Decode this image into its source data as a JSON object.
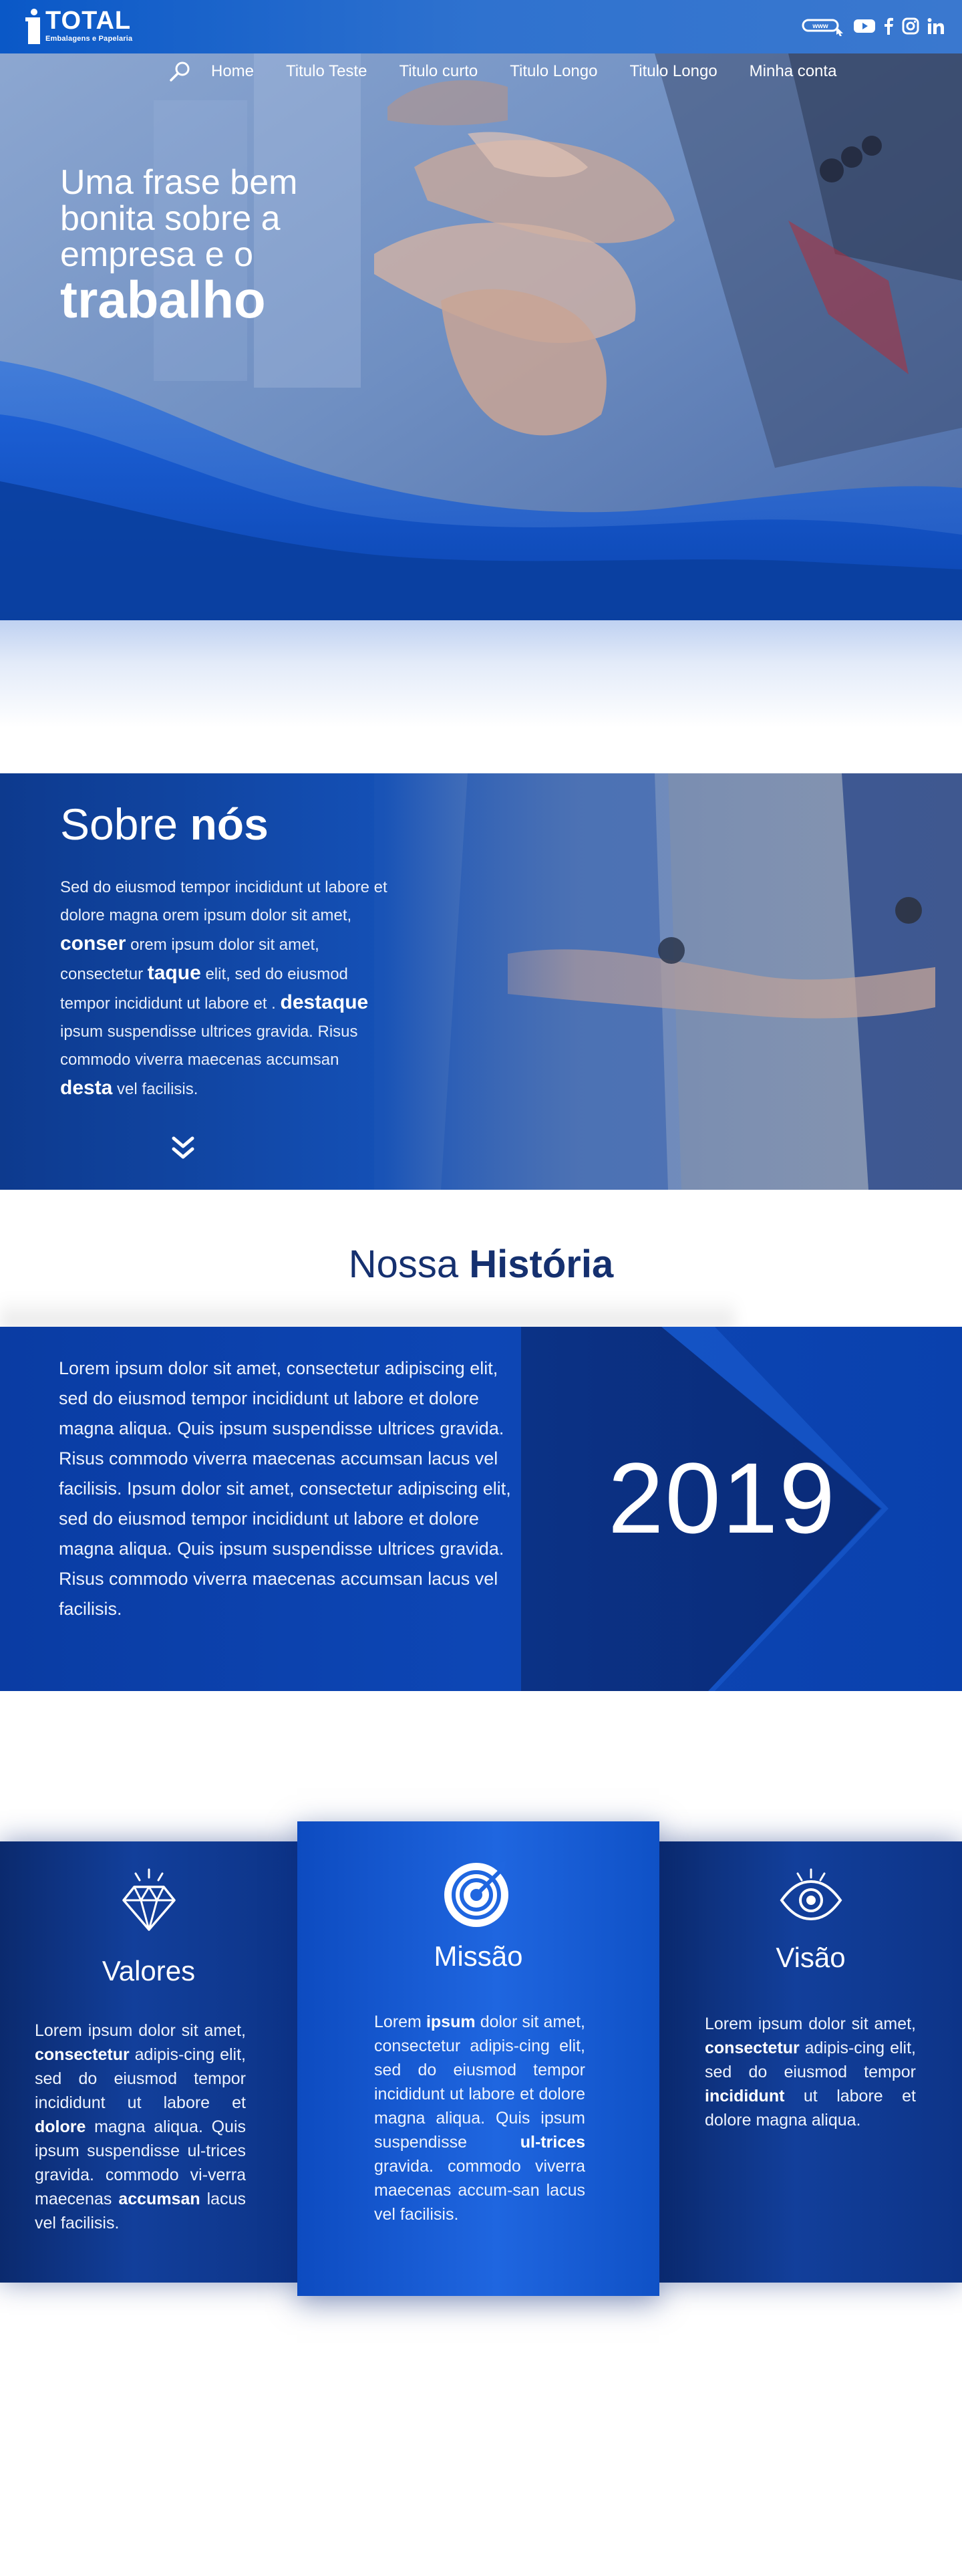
{
  "brand": {
    "name": "TOTAL",
    "tagline": "Embalagens e Papelaria"
  },
  "social": [
    "www-icon",
    "youtube-icon",
    "facebook-icon",
    "instagram-icon",
    "linkedin-icon"
  ],
  "nav": {
    "items": [
      "Home",
      "Titulo Teste",
      "Titulo curto",
      "Titulo Longo",
      "Titulo Longo",
      "Minha conta"
    ]
  },
  "hero": {
    "lines": [
      "Uma frase bem",
      "bonita sobre a",
      "empresa e o"
    ],
    "strong": "trabalho"
  },
  "sobre": {
    "title_light": "Sobre",
    "title_bold": "nós",
    "p1": "Sed do eiusmod tempor incididunt ut labore et dolore magna orem ipsum dolor sit amet,",
    "b1": "conser",
    "p2": "orem ipsum dolor sit amet, consectetur",
    "b2": "taque",
    "p3": "elit, sed do eiusmod tempor incididunt ut labore et .",
    "b3": "destaque",
    "p4": "ipsum suspendisse ultrices gravida. Risus commodo viverra maecenas accumsan",
    "b4": "desta",
    "p5": "vel facilisis."
  },
  "historia": {
    "title_light": "Nossa",
    "title_bold": "História",
    "text": "Lorem ipsum dolor sit amet, consectetur adipiscing elit, sed do eiusmod tempor incididunt ut labore et dolore magna aliqua. Quis ipsum suspendisse ultrices gravida. Risus commodo viverra maecenas accumsan lacus vel facilisis. Ipsum dolor sit amet, consectetur adipiscing elit, sed do eiusmod tempor incididunt ut labore et dolore magna aliqua. Quis ipsum suspendisse ultrices gravida. Risus commodo viverra maecenas accumsan lacus vel facilisis.",
    "year": "2019"
  },
  "cards": {
    "valores": {
      "title": "Valores",
      "t1": "Lorem ipsum dolor sit amet,",
      "b1": "consectetur",
      "t2": "adipis-cing elit, sed do eiusmod tempor incididunt ut labore et",
      "b2": "dolore",
      "t3": "magna aliqua. Quis ipsum suspendisse ul-trices gravida. commodo vi-verra maecenas",
      "b3": "accumsan",
      "t4": "lacus vel facilisis."
    },
    "missao": {
      "title": "Missão",
      "t1": "Lorem",
      "b1": "ipsum",
      "t2": "dolor sit amet, consectetur adipis-cing elit, sed do eiusmod tempor incididunt ut labore et dolore magna aliqua. Quis ipsum suspendisse",
      "b2": "ul-trices",
      "t3": "gravida. commodo viverra maecenas accum-san lacus vel facilisis."
    },
    "visao": {
      "title": "Visão",
      "t1": "Lorem ipsum dolor sit amet,",
      "b1": "consectetur",
      "t2": "adipis-cing elit, sed do eiusmod tempor",
      "b2": "incididunt",
      "t3": "ut labore et dolore magna aliqua."
    }
  },
  "colors": {
    "primary": "#0c47b6",
    "dark": "#0b2a6e",
    "heading": "#15306f"
  }
}
